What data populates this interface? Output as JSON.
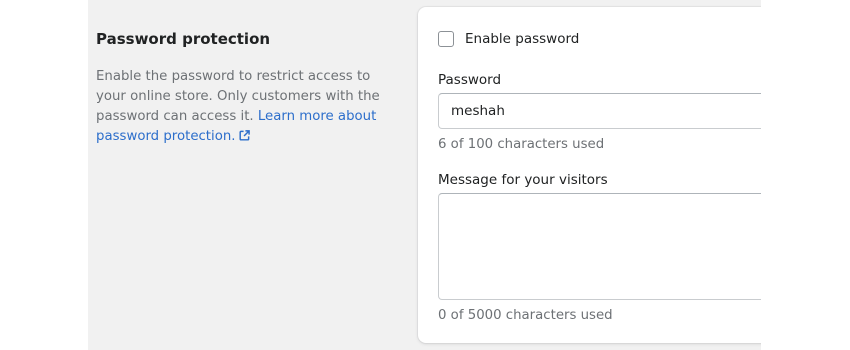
{
  "section": {
    "title": "Password protection",
    "description": "Enable the password to restrict access to your online store. Only customers with the password can access it. ",
    "link_text": "Learn more about password protection.",
    "link_icon": "external-link-icon"
  },
  "enable_password": {
    "label": "Enable password",
    "checked": false
  },
  "password": {
    "label": "Password",
    "value": "meshah",
    "help": "6 of 100 characters used"
  },
  "message": {
    "label": "Message for your visitors",
    "value": "",
    "help": "0 of 5000 characters used"
  },
  "colors": {
    "page_background": "#f1f1f1",
    "card_background": "#ffffff",
    "link": "#2c6ecb",
    "subdued_text": "#6d7175",
    "border": "#c9cccf"
  }
}
